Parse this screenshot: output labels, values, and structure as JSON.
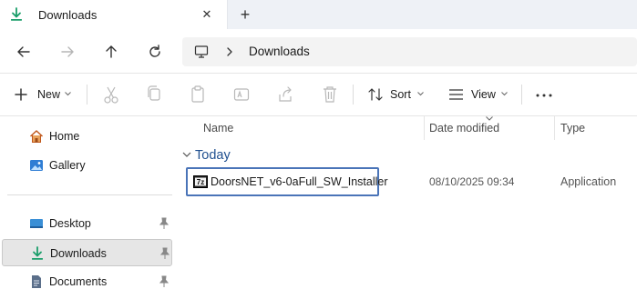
{
  "tab": {
    "title": "Downloads",
    "icon": "download-icon",
    "close_icon": "close-icon",
    "new_tab_icon": "plus-icon"
  },
  "navigation": {
    "back_icon": "arrow-left-icon",
    "forward_icon": "arrow-right-icon",
    "up_icon": "arrow-up-icon",
    "refresh_icon": "refresh-icon",
    "address": {
      "root_icon": "computer-icon",
      "separator_icon": "chevron-right-icon",
      "current": "Downloads"
    }
  },
  "toolbar": {
    "new_label": "New",
    "sort_label": "Sort",
    "view_label": "View",
    "more_icon": "more-icon",
    "actions": [
      "cut-icon",
      "copy-icon",
      "paste-icon",
      "rename-icon",
      "share-icon",
      "delete-icon"
    ]
  },
  "sidebar": {
    "items": [
      {
        "label": "Home",
        "icon": "home-icon",
        "pinned": false,
        "selected": false
      },
      {
        "label": "Gallery",
        "icon": "gallery-icon",
        "pinned": false,
        "selected": false
      },
      {
        "label": "Desktop",
        "icon": "desktop-icon",
        "pinned": true,
        "selected": false
      },
      {
        "label": "Downloads",
        "icon": "download-icon",
        "pinned": true,
        "selected": true
      },
      {
        "label": "Documents",
        "icon": "documents-icon",
        "pinned": true,
        "selected": false
      }
    ]
  },
  "file_list": {
    "columns": [
      "Name",
      "Date modified",
      "Type"
    ],
    "sorted_by": "Date modified",
    "groups": [
      {
        "label": "Today",
        "files": [
          {
            "name": "DoorsNET_v6-0aFull_SW_Installer",
            "date_modified": "08/10/2025 09:34",
            "type": "Application",
            "icon": "installer-icon"
          }
        ]
      }
    ]
  },
  "colors": {
    "accent": "#1f4f8f",
    "highlight_border": "#4a74b8",
    "download_green": "#1a9e6a",
    "selected_bg": "#e6e6e6"
  }
}
